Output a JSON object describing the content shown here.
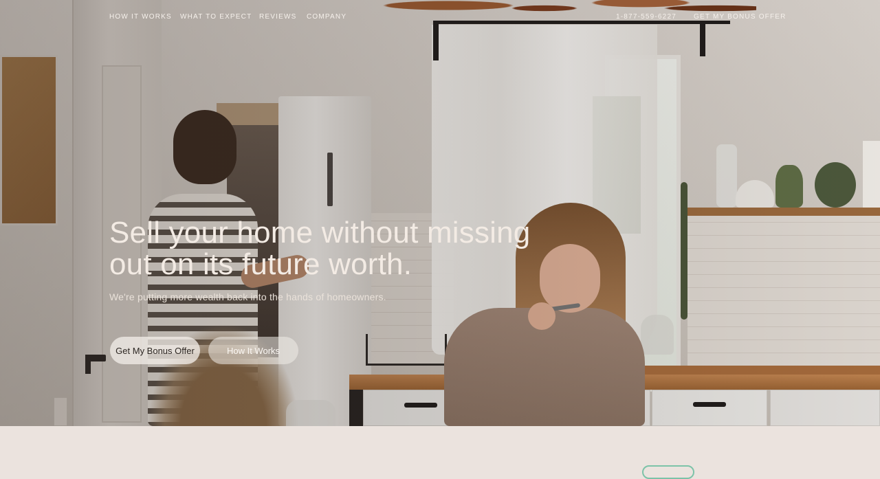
{
  "nav": {
    "links": [
      {
        "label": "HOW IT WORKS"
      },
      {
        "label": "WHAT TO EXPECT"
      },
      {
        "label": "REVIEWS"
      },
      {
        "label": "COMPANY"
      }
    ],
    "phone": "1-877-559-6227",
    "cta": "GET MY BONUS OFFER"
  },
  "hero": {
    "headline_line1": "Sell your home without missing",
    "headline_line2": "out on its future worth.",
    "subhead": "We're putting more wealth back into the hands of homeowners.",
    "primary_button": "Get My Bonus Offer",
    "secondary_button": "How It Works"
  },
  "colors": {
    "text_light": "#f3ebe4",
    "section_bg": "#ebe3de",
    "accent_outline": "#7cc3a8"
  }
}
